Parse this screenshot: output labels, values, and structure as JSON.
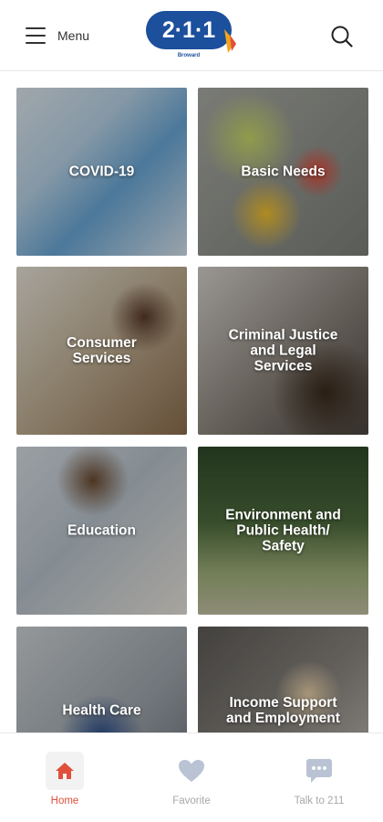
{
  "header": {
    "menu_label": "Menu",
    "logo_text": "2·1·1",
    "logo_subtext": "Broward",
    "search_icon": "search-icon"
  },
  "tiles": [
    {
      "label": "COVID-19",
      "icon": "covid-photo"
    },
    {
      "label": "Basic Needs",
      "icon": "basic-needs-photo"
    },
    {
      "label": "Consumer\nServices",
      "icon": "consumer-photo"
    },
    {
      "label": "Criminal Justice\nand Legal\nServices",
      "icon": "criminal-justice-photo"
    },
    {
      "label": "Education",
      "icon": "education-photo"
    },
    {
      "label": "Environment and\nPublic Health/\nSafety",
      "icon": "environment-photo"
    },
    {
      "label": "Health Care",
      "icon": "health-care-photo"
    },
    {
      "label": "Income Support\nand Employment",
      "icon": "income-photo"
    }
  ],
  "bottom_nav": [
    {
      "label": "Home",
      "icon": "home-icon",
      "active": true
    },
    {
      "label": "Favorite",
      "icon": "heart-icon",
      "active": false
    },
    {
      "label": "Talk to 211",
      "icon": "chat-icon",
      "active": false
    }
  ],
  "colors": {
    "brand_blue": "#1c4f9c",
    "accent_orange": "#e0503a",
    "inactive_gray": "#a8a8a8"
  }
}
